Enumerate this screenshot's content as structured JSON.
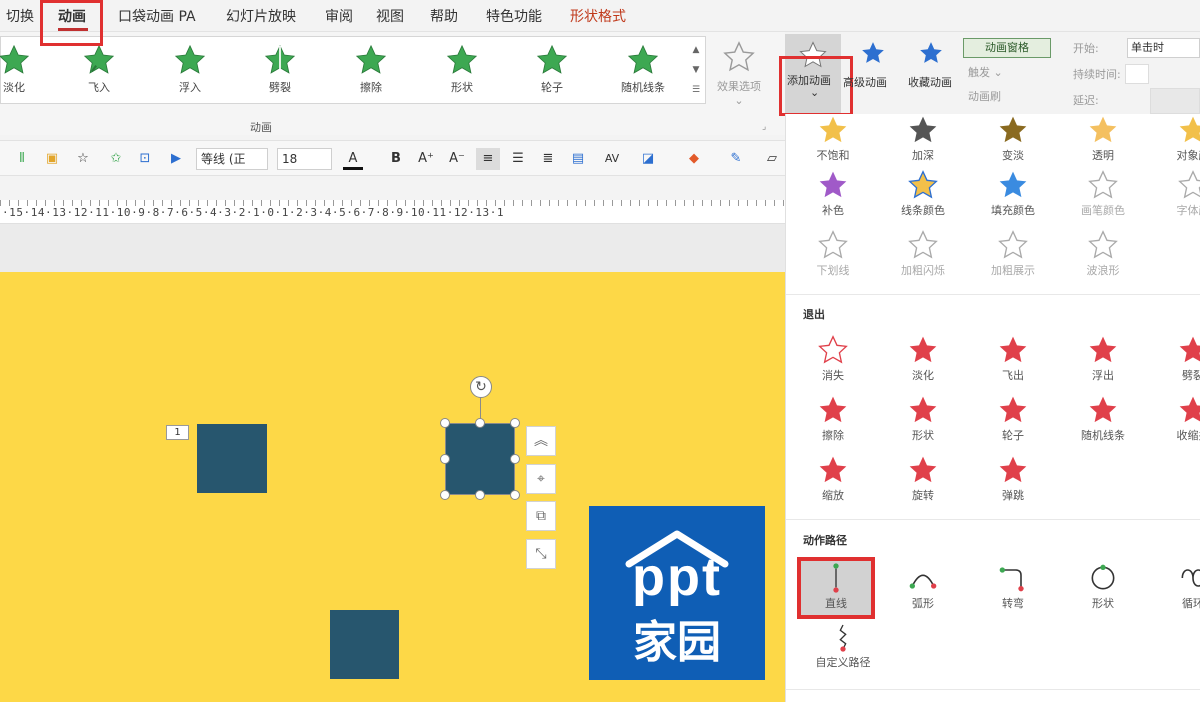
{
  "tabs": [
    {
      "label": "切换"
    },
    {
      "label": "动画"
    },
    {
      "label": "口袋动画 PA"
    },
    {
      "label": "幻灯片放映"
    },
    {
      "label": "审阅"
    },
    {
      "label": "视图"
    },
    {
      "label": "帮助"
    },
    {
      "label": "特色功能"
    },
    {
      "label": "形状格式"
    }
  ],
  "ribbon": {
    "gallery": [
      "淡化",
      "飞入",
      "浮入",
      "劈裂",
      "擦除",
      "形状",
      "轮子",
      "随机线条"
    ],
    "effect_options": "效果选项",
    "group_label": "动画",
    "add_animation": "添加动画",
    "add_animation_arrow": "⌄",
    "advanced_animation": "高级动画",
    "favorite_animation": "收藏动画",
    "animation_pane": "动画窗格",
    "trigger": "触发 ⌄",
    "animation_painter": "动画刷",
    "start_label": "开始:",
    "start_value": "单击时",
    "duration_label": "持续时间:",
    "delay_label": "延迟:"
  },
  "toolbar": {
    "font_name": "等线 (正",
    "font_size": "18",
    "bold": "B",
    "grow": "A⁺",
    "shrink": "A⁻",
    "font_color": "A",
    "spacing": "AV"
  },
  "ruler": "·15·14·13·12·11·10·9·8·7·6·5·4·3·2·1·0·1·2·3·4·5·6·7·8·9·10·11·12·13·1",
  "slide": {
    "badge": "1",
    "logo_top": "ppt",
    "logo_bottom": "家园"
  },
  "pane": {
    "emphasis": [
      "不饱和",
      "加深",
      "变淡",
      "透明",
      "对象颜",
      "补色",
      "线条颜色",
      "填充颜色",
      "画笔颜色",
      "字体颜",
      "下划线",
      "加粗闪烁",
      "加粗展示",
      "波浪形"
    ],
    "exit_title": "退出",
    "exit": [
      "消失",
      "淡化",
      "飞出",
      "浮出",
      "劈裂",
      "擦除",
      "形状",
      "轮子",
      "随机线条",
      "收缩并",
      "缩放",
      "旋转",
      "弹跳"
    ],
    "path_title": "动作路径",
    "paths": [
      "直线",
      "弧形",
      "转弯",
      "形状",
      "循环",
      "自定义路径"
    ]
  },
  "colors": {
    "slide_bg": "#fdd847",
    "shape": "#27566e",
    "logo_bg": "#0f5eb5",
    "highlight": "#e03030",
    "entrance_star": "#3da852",
    "exit_star": "#e0404a"
  }
}
